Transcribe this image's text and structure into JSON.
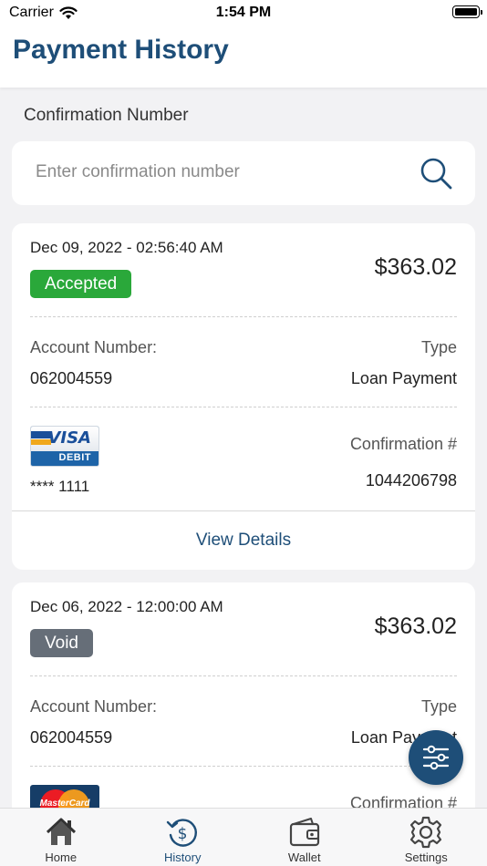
{
  "status_bar": {
    "carrier": "Carrier",
    "time": "1:54 PM"
  },
  "header": {
    "title": "Payment History"
  },
  "search": {
    "label": "Confirmation Number",
    "placeholder": "Enter confirmation number"
  },
  "payments": [
    {
      "date": "Dec 09, 2022 - 02:56:40 AM",
      "status": "Accepted",
      "amount": "$363.02",
      "account_label": "Account Number:",
      "account_number": "062004559",
      "type_label": "Type",
      "type_value": "Loan Payment",
      "card_brand": "VISA",
      "card_kind": "DEBIT",
      "card_masked": "**** 1111",
      "confirmation_label": "Confirmation #",
      "confirmation_number": "1044206798",
      "view_details": "View Details"
    },
    {
      "date": "Dec 06, 2022 - 12:00:00 AM",
      "status": "Void",
      "amount": "$363.02",
      "account_label": "Account Number:",
      "account_number": "062004559",
      "type_label": "Type",
      "type_value": "Loan Payment",
      "card_brand": "MasterCard",
      "confirmation_label": "Confirmation #"
    }
  ],
  "tabs": [
    {
      "label": "Home",
      "icon": "home-icon"
    },
    {
      "label": "History",
      "icon": "history-dollar-icon",
      "active": true
    },
    {
      "label": "Wallet",
      "icon": "wallet-icon"
    },
    {
      "label": "Settings",
      "icon": "gear-icon"
    }
  ],
  "colors": {
    "brand": "#1e4e78",
    "accepted": "#2aa83a",
    "void": "#666e78",
    "background": "#f2f2f4"
  }
}
